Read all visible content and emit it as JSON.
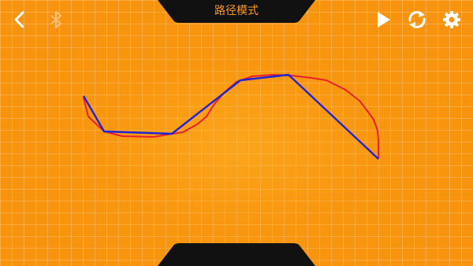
{
  "header": {
    "title": "路径模式"
  },
  "icons": {
    "back": "chevron-left-icon",
    "bluetooth": "bluetooth-icon",
    "play": "play-icon",
    "reset": "refresh-icon",
    "settings": "gear-icon"
  },
  "colors": {
    "background": "#f7930e",
    "grid": "rgba(255,255,255,0.22)",
    "tab": "#111111",
    "title_text": "#ff9a1e",
    "drawn_path": "#e8202a",
    "fitted_path": "#2323d6",
    "icon_active": "#ffffff",
    "icon_inactive": "#f9c27a"
  },
  "bluetooth_connected": false
}
